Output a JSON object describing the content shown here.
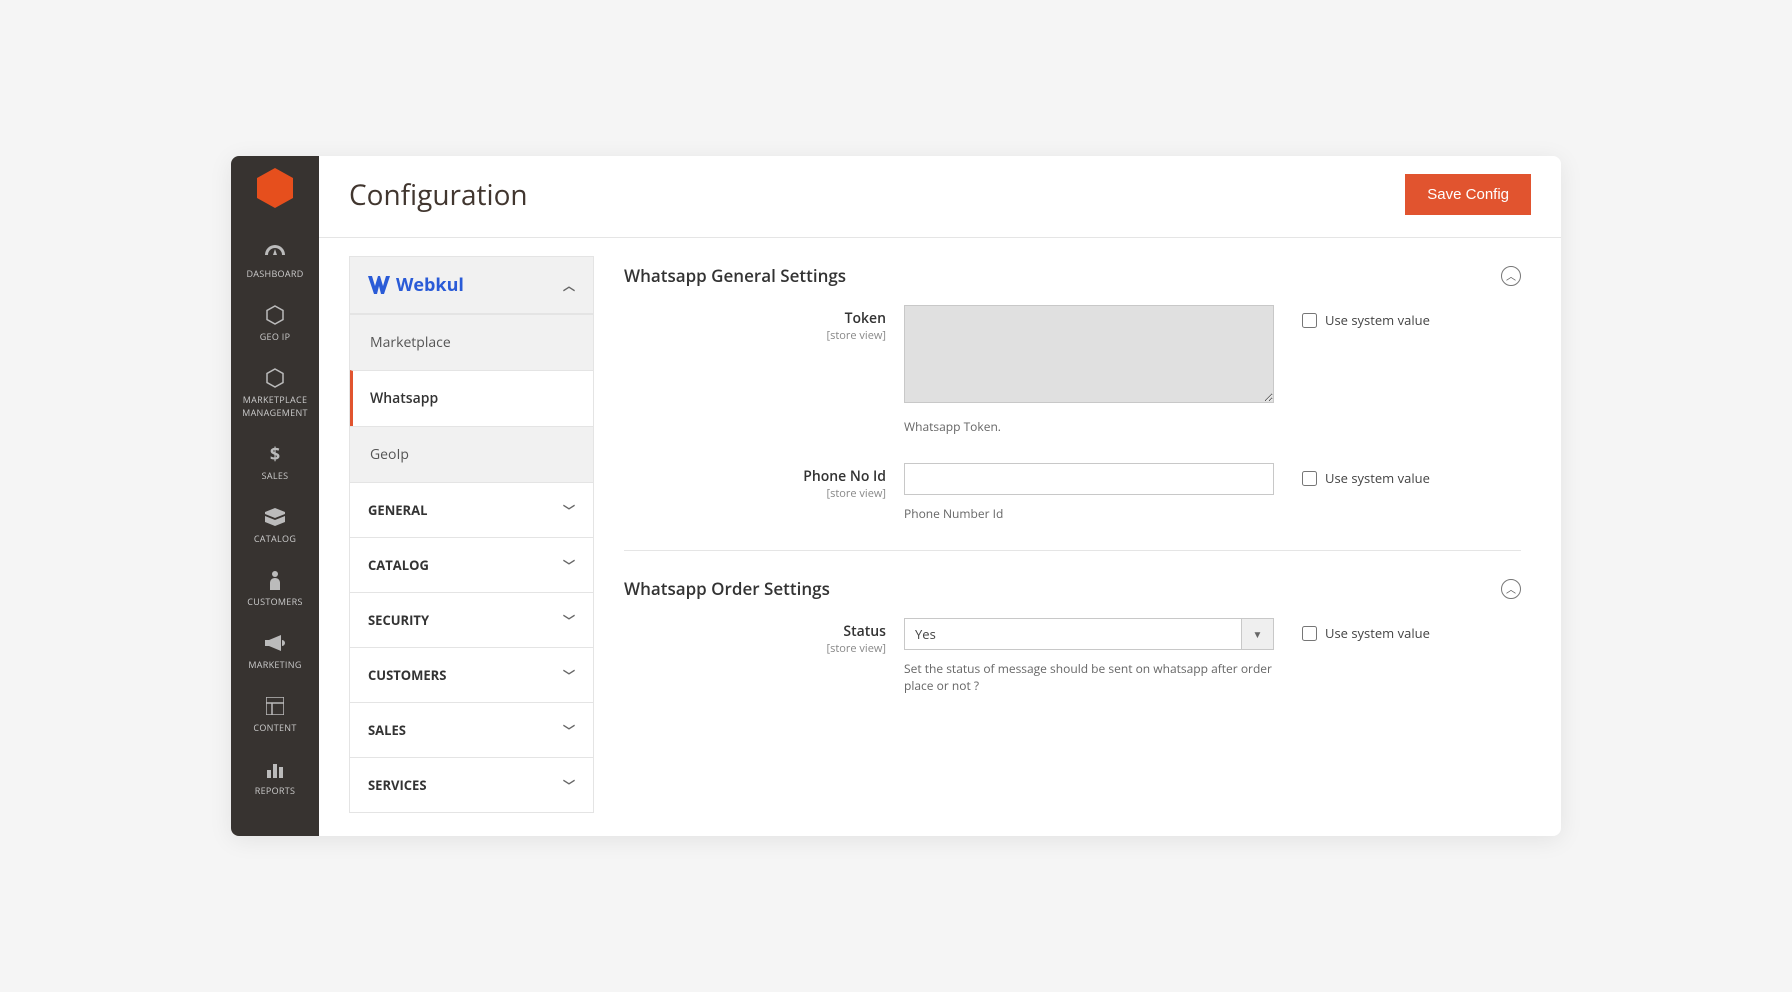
{
  "page": {
    "title": "Configuration",
    "save_button": "Save Config"
  },
  "leftnav": {
    "items": [
      {
        "label": "DASHBOARD"
      },
      {
        "label": "GEO IP"
      },
      {
        "label": "MARKETPLACE MANAGEMENT"
      },
      {
        "label": "SALES"
      },
      {
        "label": "CATALOG"
      },
      {
        "label": "CUSTOMERS"
      },
      {
        "label": "MARKETING"
      },
      {
        "label": "CONTENT"
      },
      {
        "label": "REPORTS"
      }
    ]
  },
  "configtabs": {
    "webkul": {
      "label": "Webkul",
      "subitems": [
        {
          "label": "Marketplace"
        },
        {
          "label": "Whatsapp"
        },
        {
          "label": "GeoIp"
        }
      ]
    },
    "groups": [
      {
        "label": "GENERAL"
      },
      {
        "label": "CATALOG"
      },
      {
        "label": "SECURITY"
      },
      {
        "label": "CUSTOMERS"
      },
      {
        "label": "SALES"
      },
      {
        "label": "SERVICES"
      }
    ]
  },
  "sections": {
    "general": {
      "title": "Whatsapp General Settings",
      "token": {
        "label": "Token",
        "scope": "[store view]",
        "value": "",
        "hint": "Whatsapp Token.",
        "use_system": "Use system value"
      },
      "phone": {
        "label": "Phone No Id",
        "scope": "[store view]",
        "value": "",
        "hint": "Phone Number Id",
        "use_system": "Use system value"
      }
    },
    "order": {
      "title": "Whatsapp Order Settings",
      "status": {
        "label": "Status",
        "scope": "[store view]",
        "value": "Yes",
        "hint": "Set the status of message should be sent on whatsapp after order place or not ?",
        "use_system": "Use system value"
      }
    }
  }
}
